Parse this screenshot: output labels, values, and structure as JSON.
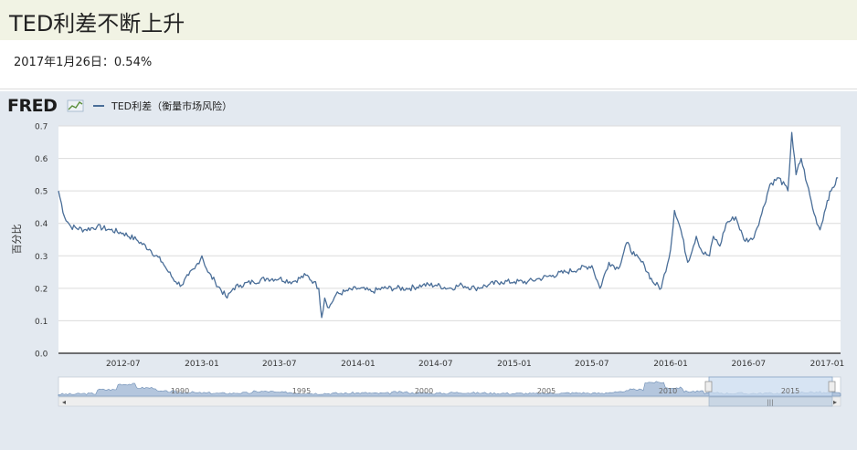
{
  "page": {
    "title": "TED利差不断上升",
    "subtitle": "2017年1月26日：0.54%"
  },
  "fred": {
    "logo_text": "FRED",
    "logo_icon": "line-chart-icon",
    "series_label": "TED利差（衡量市场风险）"
  },
  "colors": {
    "line": "#4a6e98",
    "panel": "#e3e9f0",
    "title_bar": "#f1f3e4",
    "navigator_fill": "#b4c6dd",
    "navigator_window": "#c9dbef"
  },
  "navigator": {
    "labels": [
      "1990",
      "1995",
      "2000",
      "2005",
      "2010",
      "2015"
    ],
    "scroll_left_icon": "chevron-left-icon",
    "scroll_right_icon": "chevron-right-icon",
    "scroll_thumb_icon": "grip-icon",
    "window_handle_icon": "drag-handle-icon"
  },
  "chart_data": {
    "type": "line",
    "title": "",
    "xlabel": "",
    "ylabel": "百分比",
    "ylim": [
      0,
      0.7
    ],
    "yticks": [
      "0.0",
      "0.1",
      "0.2",
      "0.3",
      "0.4",
      "0.5",
      "0.6",
      "0.7"
    ],
    "xticks": [
      "2012-07",
      "2013-01",
      "2013-07",
      "2014-01",
      "2014-07",
      "2015-01",
      "2015-07",
      "2016-01",
      "2016-07",
      "2017-01"
    ],
    "xrange": [
      "2012-02",
      "2017-02"
    ],
    "grid": true,
    "legend": "top-left",
    "series": [
      {
        "name": "TED利差（衡量市场风险）",
        "x": [
          "2012-02-01",
          "2012-02-15",
          "2012-03-01",
          "2012-04-01",
          "2012-05-01",
          "2012-06-01",
          "2012-07-01",
          "2012-08-01",
          "2012-09-01",
          "2012-10-01",
          "2012-10-15",
          "2012-11-01",
          "2012-11-15",
          "2012-12-01",
          "2012-12-15",
          "2013-01-01",
          "2013-01-15",
          "2013-02-01",
          "2013-03-01",
          "2013-03-15",
          "2013-04-01",
          "2013-05-01",
          "2013-06-01",
          "2013-07-01",
          "2013-08-01",
          "2013-09-01",
          "2013-09-20",
          "2013-10-01",
          "2013-10-08",
          "2013-10-15",
          "2013-10-25",
          "2013-11-10",
          "2013-12-01",
          "2014-01-01",
          "2014-02-01",
          "2014-03-01",
          "2014-04-01",
          "2014-05-01",
          "2014-06-01",
          "2014-07-01",
          "2014-08-01",
          "2014-09-01",
          "2014-10-01",
          "2014-11-01",
          "2014-12-01",
          "2015-01-01",
          "2015-02-01",
          "2015-03-01",
          "2015-04-01",
          "2015-05-01",
          "2015-06-01",
          "2015-07-01",
          "2015-07-20",
          "2015-08-10",
          "2015-09-01",
          "2015-09-20",
          "2015-10-10",
          "2015-11-01",
          "2015-11-20",
          "2015-12-10",
          "2016-01-01",
          "2016-01-10",
          "2016-01-25",
          "2016-02-10",
          "2016-03-01",
          "2016-03-15",
          "2016-04-01",
          "2016-04-10",
          "2016-04-25",
          "2016-05-10",
          "2016-06-01",
          "2016-06-20",
          "2016-07-10",
          "2016-08-01",
          "2016-08-20",
          "2016-09-10",
          "2016-10-01",
          "2016-10-10",
          "2016-10-20",
          "2016-11-01",
          "2016-11-15",
          "2016-12-01",
          "2016-12-15",
          "2017-01-01",
          "2017-01-10",
          "2017-01-26"
        ],
        "values": [
          0.5,
          0.42,
          0.39,
          0.38,
          0.39,
          0.38,
          0.37,
          0.35,
          0.32,
          0.28,
          0.25,
          0.22,
          0.21,
          0.24,
          0.26,
          0.3,
          0.25,
          0.22,
          0.17,
          0.2,
          0.21,
          0.22,
          0.23,
          0.23,
          0.22,
          0.24,
          0.22,
          0.2,
          0.11,
          0.17,
          0.14,
          0.18,
          0.19,
          0.2,
          0.19,
          0.2,
          0.2,
          0.2,
          0.21,
          0.21,
          0.2,
          0.21,
          0.2,
          0.21,
          0.22,
          0.22,
          0.22,
          0.23,
          0.24,
          0.25,
          0.26,
          0.27,
          0.2,
          0.28,
          0.26,
          0.34,
          0.3,
          0.27,
          0.22,
          0.2,
          0.32,
          0.44,
          0.38,
          0.28,
          0.36,
          0.31,
          0.3,
          0.36,
          0.33,
          0.4,
          0.42,
          0.35,
          0.35,
          0.43,
          0.52,
          0.54,
          0.5,
          0.68,
          0.55,
          0.6,
          0.52,
          0.43,
          0.38,
          0.47,
          0.5,
          0.54
        ]
      }
    ]
  }
}
